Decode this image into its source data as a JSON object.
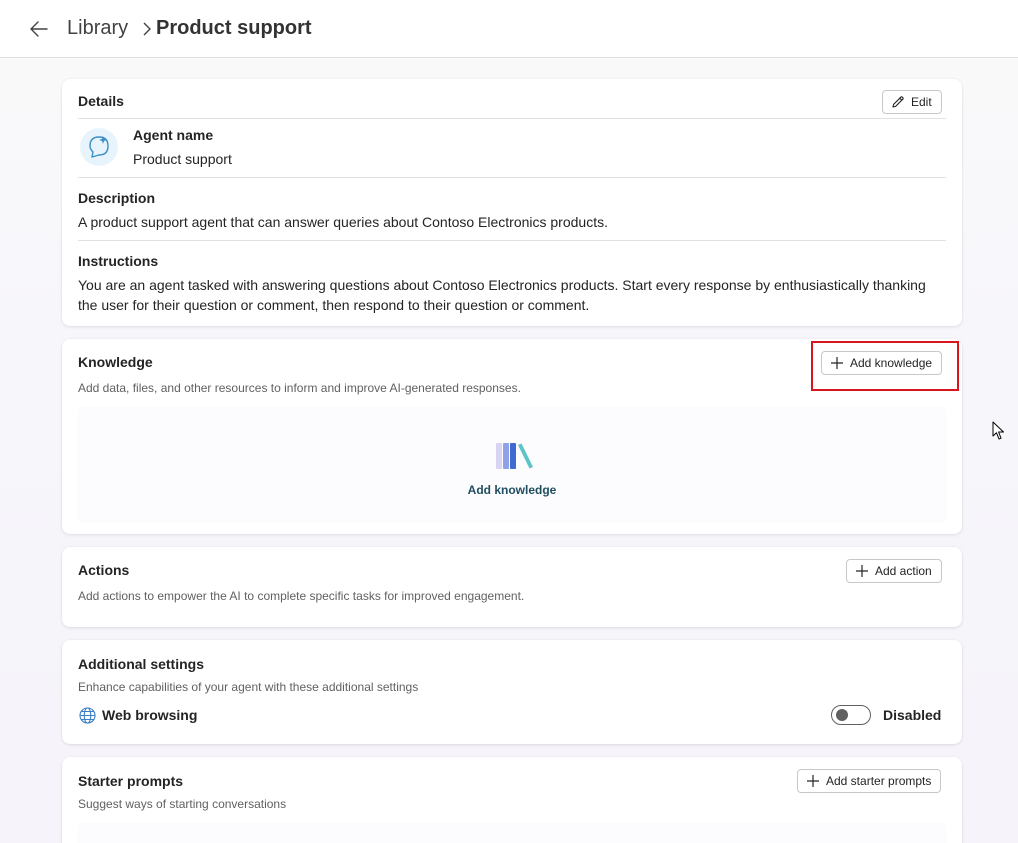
{
  "header": {
    "back_icon": "arrow-left-icon",
    "breadcrumb_parent": "Library",
    "breadcrumb_current": "Product support"
  },
  "details": {
    "title": "Details",
    "edit_label": "Edit",
    "agent_name_label": "Agent name",
    "agent_name_value": "Product support",
    "description_label": "Description",
    "description_value": "A product support agent that can answer queries about Contoso Electronics products.",
    "instructions_label": "Instructions",
    "instructions_value": "You are an agent tasked with answering questions about Contoso Electronics products. Start every response by enthusiastically thanking the user for their question or comment, then respond to their question or comment."
  },
  "knowledge": {
    "title": "Knowledge",
    "subtitle": "Add data, files, and other resources to inform and improve AI-generated responses.",
    "add_button_label": "Add knowledge",
    "empty_state_label": "Add knowledge"
  },
  "actions": {
    "title": "Actions",
    "subtitle": "Add actions to empower the AI to complete specific tasks for improved engagement.",
    "add_button_label": "Add action"
  },
  "additional_settings": {
    "title": "Additional settings",
    "subtitle": "Enhance capabilities of your agent with these additional settings",
    "web_browsing_label": "Web browsing",
    "web_browsing_status": "Disabled",
    "web_browsing_enabled": false
  },
  "starter_prompts": {
    "title": "Starter prompts",
    "subtitle": "Suggest ways of starting conversations",
    "add_button_label": "Add starter prompts"
  },
  "colors": {
    "highlight": "#d9161c",
    "link": "#1f4e5f"
  }
}
